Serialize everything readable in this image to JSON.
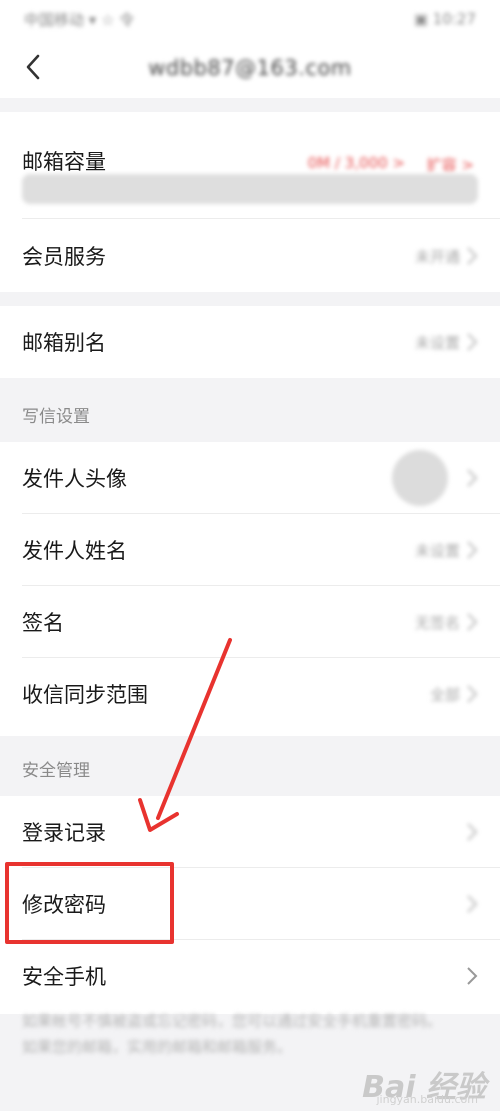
{
  "status_bar": {
    "left_text": "中国移动 ▾ ☆ 令",
    "right_text": "▣ 10:27"
  },
  "nav": {
    "back_icon": "chevron-left-icon",
    "title": "wdbb87@163.com"
  },
  "account": {
    "capacity_label": "邮箱容量",
    "capacity_value": "0M / 3,000 >",
    "expand_label": "扩容 >",
    "capacity_used_fraction": 0.0,
    "member_label": "会员服务",
    "member_value": "未开通"
  },
  "alias": {
    "label": "邮箱别名",
    "value": "未设置"
  },
  "compose_settings": {
    "header": "写信设置",
    "sender_avatar_label": "发件人头像",
    "sender_name_label": "发件人姓名",
    "sender_name_value": "未设置",
    "signature_label": "签名",
    "signature_value": "无签名",
    "sync_range_label": "收信同步范围",
    "sync_range_value": "全部"
  },
  "security": {
    "header": "安全管理",
    "login_records_label": "登录记录",
    "change_password_label": "修改密码",
    "security_phone_label": "安全手机"
  },
  "footer": {
    "note": "如果帐号不慎被盗或忘记密码，您可以通过安全手机重置密码。如果您的邮箱，实用的邮箱和邮箱服务。"
  },
  "watermark": {
    "brand": "Bai 经验",
    "url": "jingyan.baidu.com"
  },
  "colors": {
    "accent": "#e64b4b",
    "annotation": "#e8332f"
  }
}
